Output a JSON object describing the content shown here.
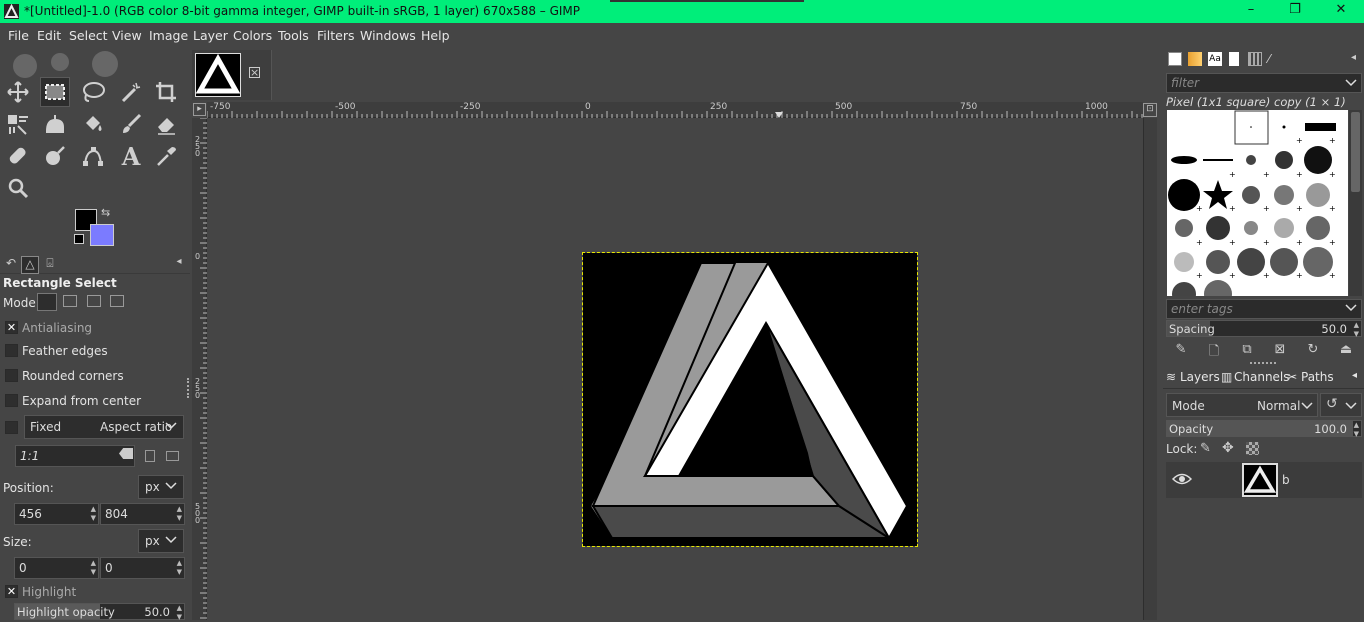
{
  "window": {
    "title": "*[Untitled]-1.0 (RGB color 8-bit gamma integer, GIMP built-in sRGB, 1 layer) 670x588 – GIMP",
    "minimize": "–",
    "maximize": "❐",
    "close": "✕"
  },
  "menu": [
    "File",
    "Edit",
    "Select",
    "View",
    "Image",
    "Layer",
    "Colors",
    "Tools",
    "Filters",
    "Windows",
    "Help"
  ],
  "tool_options": {
    "title": "Rectangle Select",
    "mode_label": "Mode:",
    "antialiasing": "Antialiasing",
    "feather": "Feather edges",
    "rounded": "Rounded corners",
    "expand": "Expand from center",
    "fixed": "Fixed",
    "fixed_option": "Aspect ratio",
    "ratio": "1:1",
    "position_label": "Position:",
    "position_unit": "px",
    "pos_x": "456",
    "pos_y": "804",
    "size_label": "Size:",
    "size_unit": "px",
    "size_w": "0",
    "size_h": "0",
    "highlight": "Highlight",
    "highlight_opacity": "Highlight opacity",
    "highlight_opacity_value": "50.0"
  },
  "colors": {
    "foreground": "#000000",
    "background": "#7b7bff",
    "titlebar": "#00ee7a",
    "selection_marquee": "#e7e700"
  },
  "ruler": {
    "h_labels": [
      "-750",
      "-500",
      "-250",
      "0",
      "250",
      "500",
      "750",
      "1000"
    ],
    "v_labels": [
      "250",
      "0",
      "250",
      "500"
    ]
  },
  "brushes": {
    "filter_placeholder": "filter",
    "selected_name": "Pixel (1x1 square) copy (1 × 1)",
    "tags_placeholder": "enter tags",
    "spacing_label": "Spacing",
    "spacing_value": "50.0"
  },
  "layers_panel": {
    "tabs": [
      "Layers",
      "Channels",
      "Paths"
    ],
    "mode_label": "Mode",
    "mode_value": "Normal",
    "opacity_label": "Opacity",
    "opacity_value": "100.0",
    "lock_label": "Lock:",
    "layers": [
      {
        "name": "b",
        "visible": true
      }
    ]
  }
}
